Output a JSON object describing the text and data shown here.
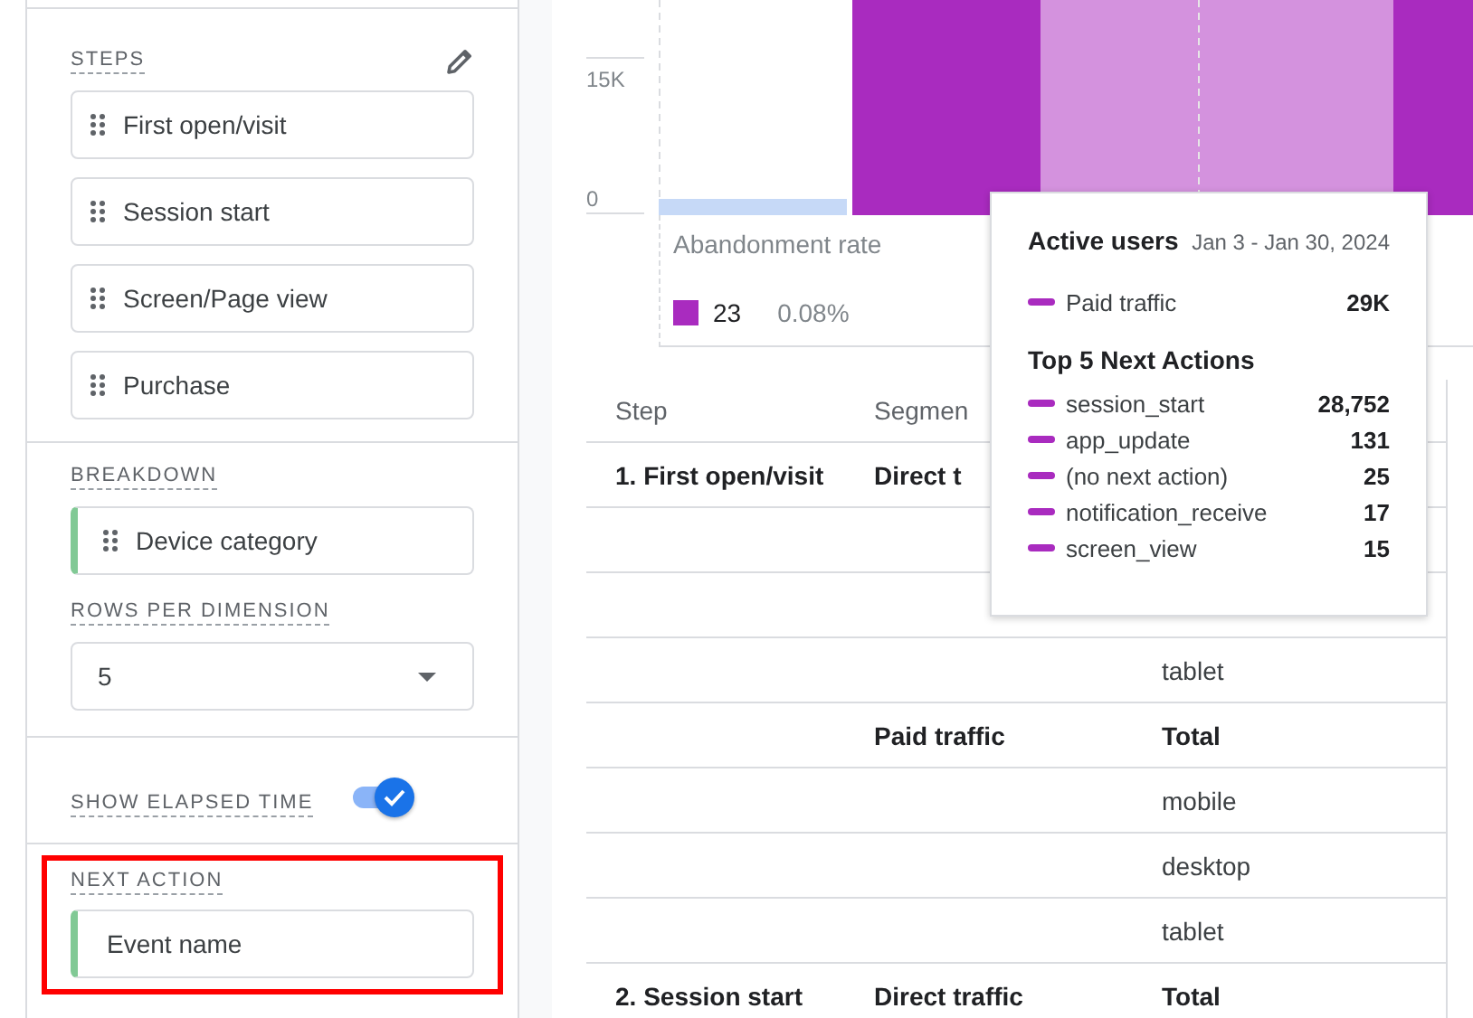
{
  "steps_panel": {
    "title": "STEPS",
    "steps": [
      "First open/visit",
      "Session start",
      "Screen/Page view",
      "Purchase"
    ]
  },
  "breakdown": {
    "title": "BREAKDOWN",
    "dimension": "Device category"
  },
  "rows_per_dimension": {
    "title": "ROWS PER DIMENSION",
    "value": "5"
  },
  "elapsed_time": {
    "label": "SHOW ELAPSED TIME",
    "on": true
  },
  "next_action": {
    "title": "NEXT ACTION",
    "value": "Event name",
    "highlighted": true
  },
  "chart": {
    "yticks": [
      "15K",
      "0"
    ],
    "label": "Abandonment rate",
    "legend": {
      "value": "23",
      "percent": "0.08%",
      "color": "#a92bbf"
    }
  },
  "table": {
    "columns": [
      "Step",
      "Segmen"
    ],
    "rows": [
      {
        "kind": "total",
        "step": "1. First open/visit",
        "segment": "Direct t"
      },
      {
        "kind": "detail"
      },
      {
        "kind": "detail"
      },
      {
        "kind": "detail",
        "device": "tablet"
      },
      {
        "kind": "total",
        "segment": "Paid traffic",
        "device": "Total"
      },
      {
        "kind": "detail",
        "device": "mobile"
      },
      {
        "kind": "detail",
        "device": "desktop"
      },
      {
        "kind": "detail",
        "device": "tablet"
      },
      {
        "kind": "total",
        "step": "2. Session start",
        "segment": "Direct traffic",
        "device": "Total"
      }
    ]
  },
  "tooltip": {
    "title": "Active users",
    "date_range": "Jan 3 - Jan 30, 2024",
    "series": {
      "name": "Paid traffic",
      "value": "29K",
      "color": "#a92bbf"
    },
    "section_title": "Top 5 Next Actions",
    "actions": [
      {
        "name": "session_start",
        "value": "28,752",
        "color": "#a92bbf"
      },
      {
        "name": "app_update",
        "value": "131",
        "color": "#a92bbf"
      },
      {
        "name": "(no next action)",
        "value": "25",
        "color": "#a92bbf"
      },
      {
        "name": "notification_receive",
        "value": "17",
        "color": "#a92bbf"
      },
      {
        "name": "screen_view",
        "value": "15",
        "color": "#a92bbf"
      }
    ]
  }
}
